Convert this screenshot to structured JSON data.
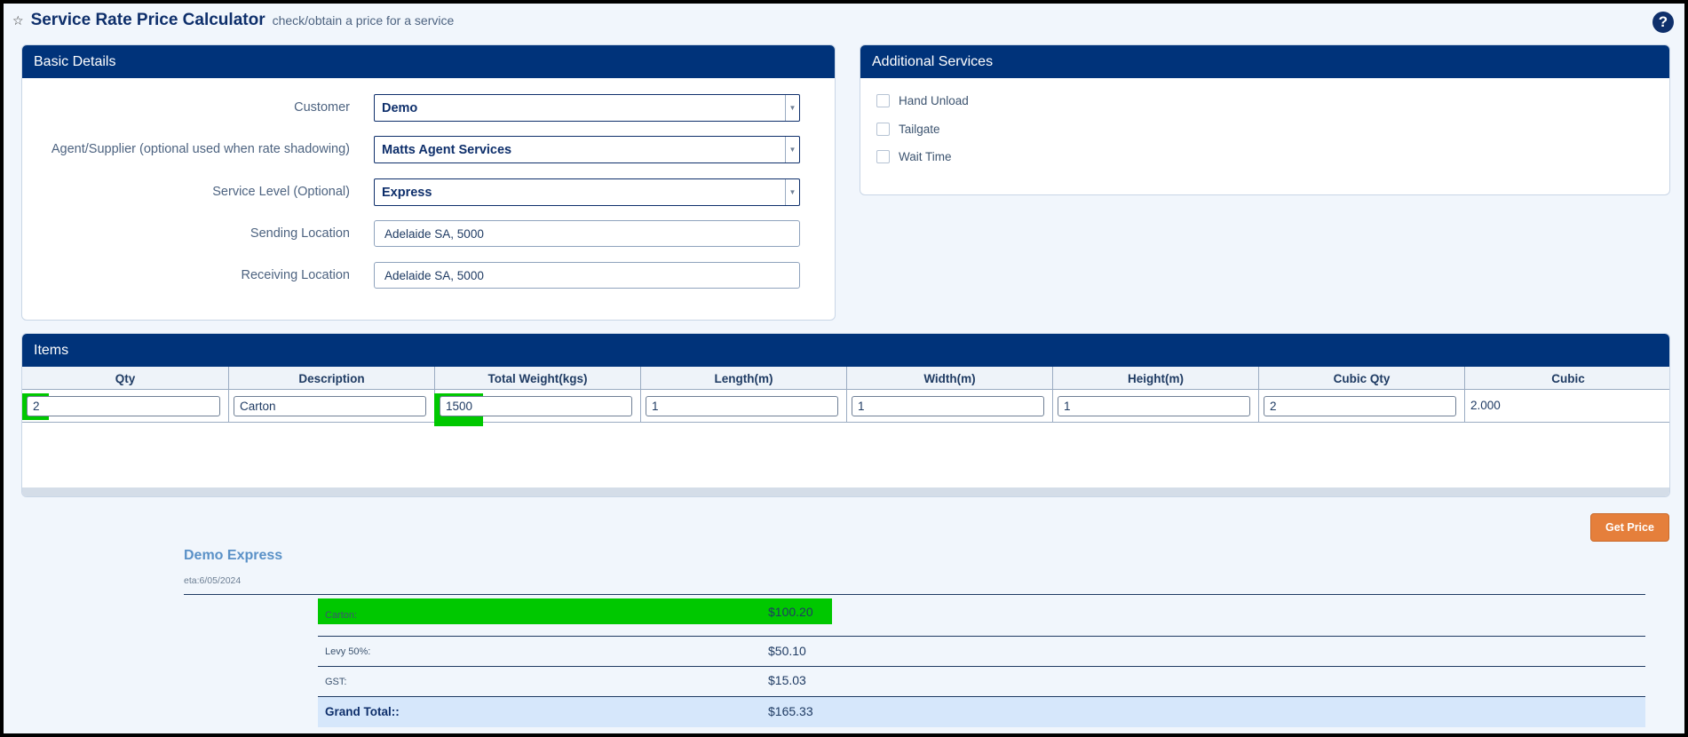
{
  "header": {
    "title": "Service Rate Price Calculator",
    "subtitle": "check/obtain a price for a service",
    "star_glyph": "☆",
    "help_glyph": "?"
  },
  "basic_details": {
    "title": "Basic Details",
    "customer": {
      "label": "Customer",
      "value": "Demo"
    },
    "agent": {
      "label": "Agent/Supplier (optional used when rate shadowing)",
      "value": "Matts Agent Services"
    },
    "service_level": {
      "label": "Service Level (Optional)",
      "value": "Express"
    },
    "sending": {
      "label": "Sending Location",
      "value": "Adelaide SA, 5000"
    },
    "receiving": {
      "label": "Receiving Location",
      "value": "Adelaide SA, 5000"
    }
  },
  "additional_services": {
    "title": "Additional Services",
    "options": [
      {
        "label": "Hand Unload",
        "checked": false
      },
      {
        "label": "Tailgate",
        "checked": false
      },
      {
        "label": "Wait Time",
        "checked": false
      }
    ]
  },
  "items": {
    "title": "Items",
    "columns": [
      "Qty",
      "Description",
      "Total Weight(kgs)",
      "Length(m)",
      "Width(m)",
      "Height(m)",
      "Cubic Qty",
      "Cubic"
    ],
    "row": {
      "qty": "2",
      "description": "Carton",
      "weight": "1500",
      "length": "1",
      "width": "1",
      "height": "1",
      "cubic_qty": "2",
      "cubic": "2.000"
    }
  },
  "actions": {
    "get_price": "Get Price"
  },
  "result": {
    "title": "Demo Express",
    "eta": "eta:6/05/2024",
    "lines": [
      {
        "label": "Carton:",
        "value": "$100.20"
      },
      {
        "label": "Levy 50%:",
        "value": "$50.10"
      },
      {
        "label": "GST:",
        "value": "$15.03"
      }
    ],
    "grand_total": {
      "label": "Grand Total::",
      "value": "$165.33"
    }
  },
  "colors": {
    "panel_header": "#00337a",
    "button": "#e57f3b",
    "highlight": "#00c800",
    "grand_total_bg": "#d6e7fb"
  }
}
